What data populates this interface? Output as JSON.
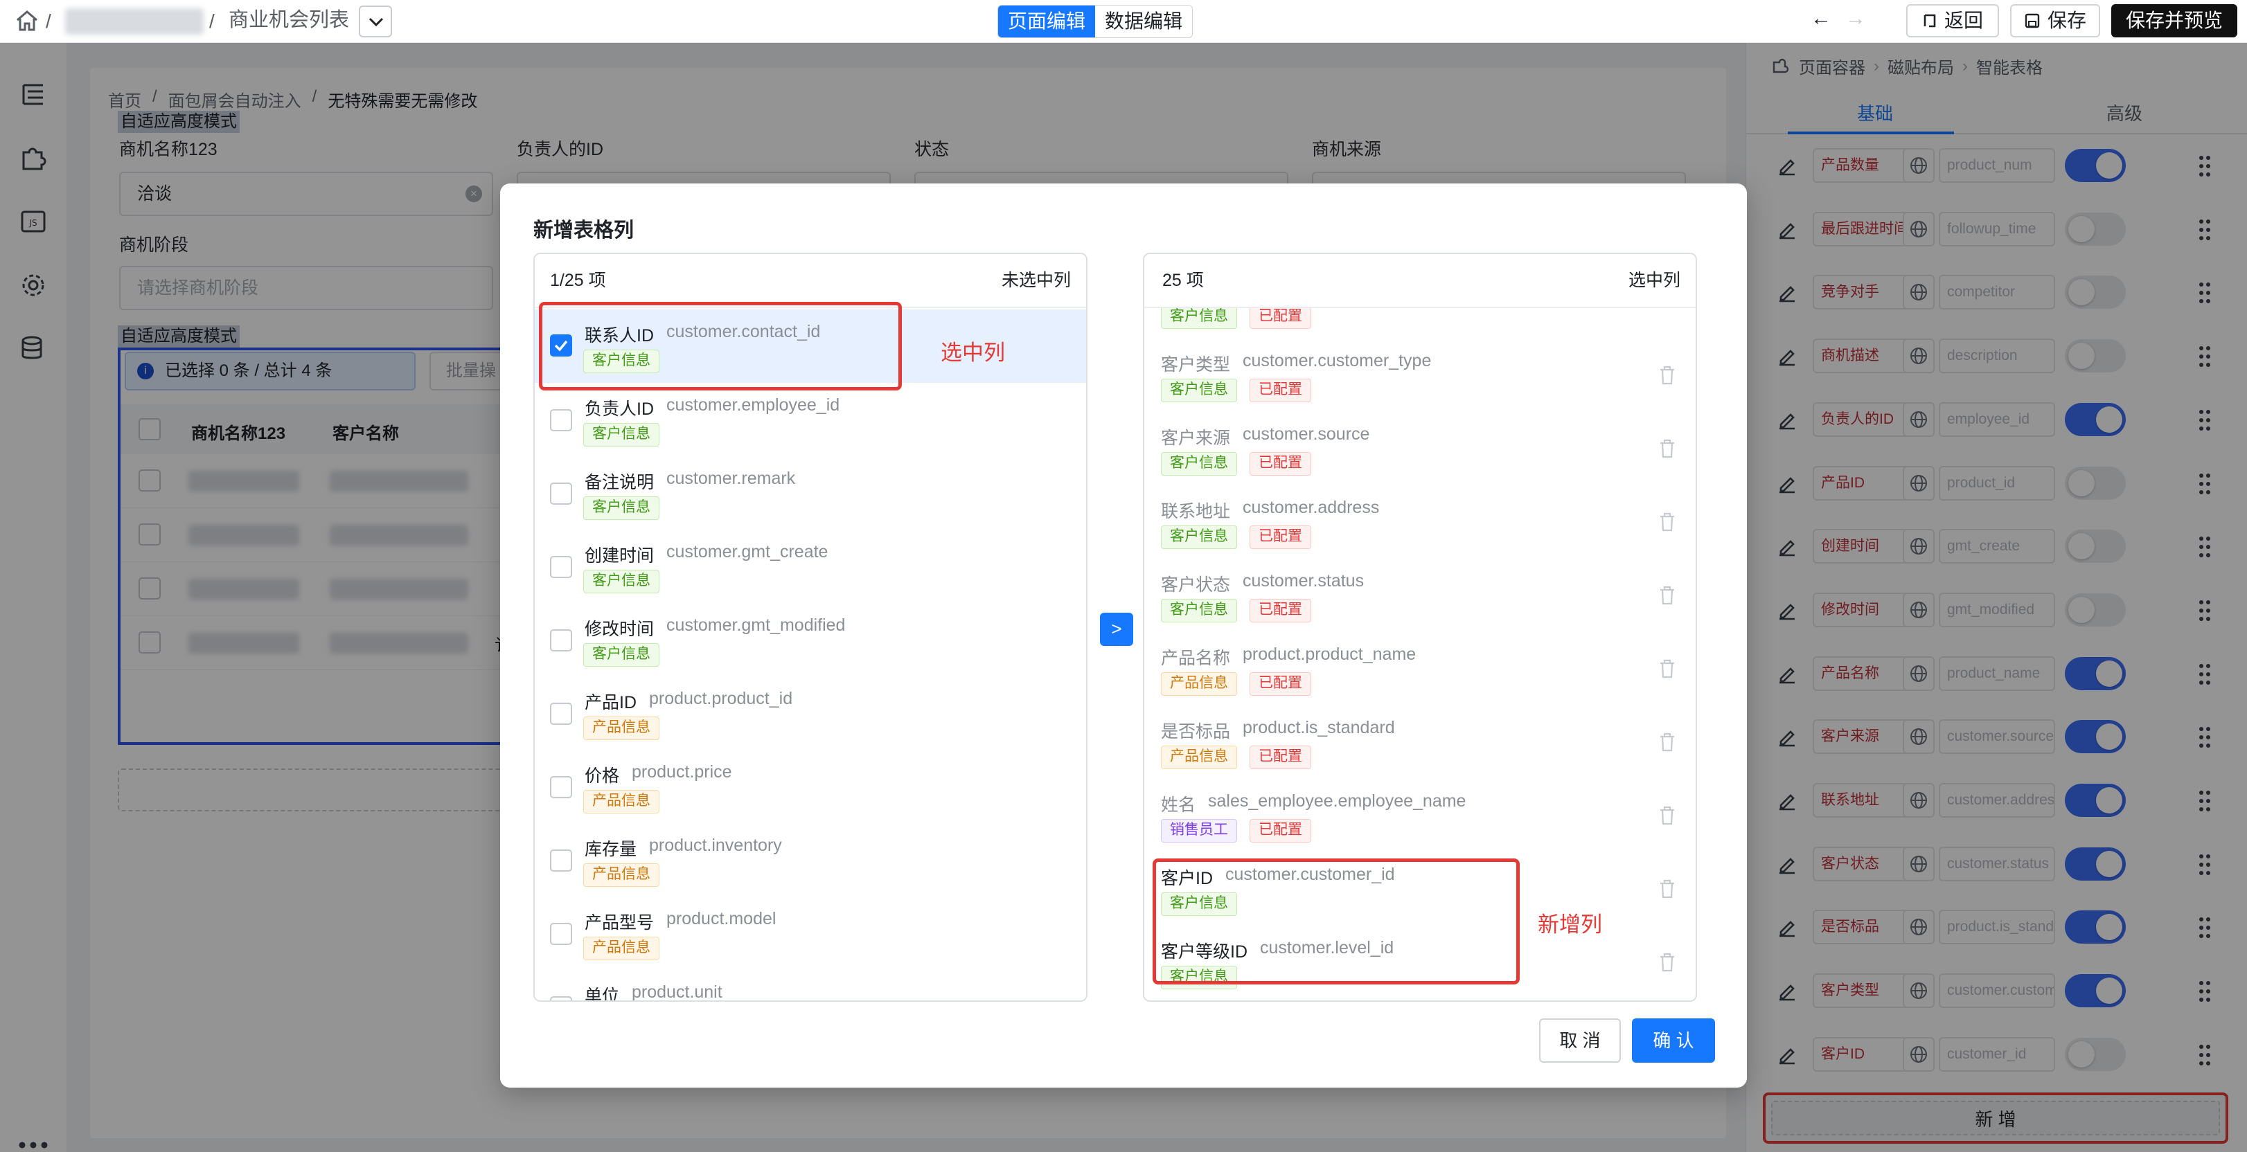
{
  "topbar": {
    "breadcrumb_sep1": "/",
    "breadcrumb_sep2": "/",
    "page_name": "商业机会列表",
    "mode_page_edit": "页面编辑",
    "mode_data_edit": "数据编辑",
    "undo": "←",
    "redo": "→",
    "back_label": "返回",
    "save_label": "保存",
    "save_preview_label": "保存并预览"
  },
  "canvas": {
    "breadcrumb": [
      "首页",
      "/",
      "面包屑会自动注入",
      "/",
      "无特殊需要无需修改"
    ],
    "adaptive_label_1": "自适应高度模式",
    "adaptive_label_2": "自适应高度模式",
    "fields": [
      {
        "label": "商机名称123",
        "value": "洽谈"
      },
      {
        "label": "负责人的ID",
        "value": ""
      },
      {
        "label": "状态",
        "value": ""
      },
      {
        "label": "商机来源",
        "value": ""
      }
    ],
    "stage_label": "商机阶段",
    "stage_placeholder": "请选择商机阶段",
    "selection_info": "已选择 0 条 / 总计 4 条",
    "batch_label": "批量操",
    "table_headers": [
      "商机名称123",
      "客户名称"
    ],
    "partial_text": "讠"
  },
  "right_panel": {
    "breadcrumb": [
      "页面容器",
      "磁贴布局",
      "智能表格"
    ],
    "tabs": [
      {
        "label": "基础"
      },
      {
        "label": "高级"
      }
    ],
    "rows": [
      {
        "label": "产品数量",
        "field": "product_num",
        "on": true
      },
      {
        "label": "最后跟进时间",
        "field": "followup_time",
        "on": false
      },
      {
        "label": "竞争对手",
        "field": "competitor",
        "on": false
      },
      {
        "label": "商机描述",
        "field": "description",
        "on": false
      },
      {
        "label": "负责人的ID",
        "field": "employee_id",
        "on": true
      },
      {
        "label": "产品ID",
        "field": "product_id",
        "on": false
      },
      {
        "label": "创建时间",
        "field": "gmt_create",
        "on": false
      },
      {
        "label": "修改时间",
        "field": "gmt_modified",
        "on": false
      },
      {
        "label": "产品名称",
        "field": "product_name",
        "on": true
      },
      {
        "label": "客户来源",
        "field": "customer.source",
        "on": true
      },
      {
        "label": "联系地址",
        "field": "customer.address",
        "on": true
      },
      {
        "label": "客户状态",
        "field": "customer.status",
        "on": true
      },
      {
        "label": "是否标品",
        "field": "product.is_standard",
        "on": true
      },
      {
        "label": "客户类型",
        "field": "customer.customer_type",
        "on": true
      },
      {
        "label": "客户ID",
        "field": "customer_id",
        "on": false
      }
    ],
    "add_label": "新 增"
  },
  "modal": {
    "title": "新增表格列",
    "left_panel": {
      "count": "1/25 项",
      "title": "未选中列",
      "items": [
        {
          "name": "联系人ID",
          "code": "customer.contact_id",
          "tag": "客户信息",
          "checked": true
        },
        {
          "name": "负责人ID",
          "code": "customer.employee_id",
          "tag": "客户信息",
          "checked": false
        },
        {
          "name": "备注说明",
          "code": "customer.remark",
          "tag": "客户信息",
          "checked": false
        },
        {
          "name": "创建时间",
          "code": "customer.gmt_create",
          "tag": "客户信息",
          "checked": false
        },
        {
          "name": "修改时间",
          "code": "customer.gmt_modified",
          "tag": "客户信息",
          "checked": false
        },
        {
          "name": "产品ID",
          "code": "product.product_id",
          "tag": "产品信息",
          "checked": false
        },
        {
          "name": "价格",
          "code": "product.price",
          "tag": "产品信息",
          "checked": false
        },
        {
          "name": "库存量",
          "code": "product.inventory",
          "tag": "产品信息",
          "checked": false
        },
        {
          "name": "产品型号",
          "code": "product.model",
          "tag": "产品信息",
          "checked": false
        },
        {
          "name": "单位",
          "code": "product.unit",
          "tag": "",
          "checked": false
        }
      ]
    },
    "right_panel": {
      "count": "25 项",
      "title": "选中列",
      "top_partial": {
        "tag": "客户信息",
        "status": "已配置"
      },
      "items": [
        {
          "name": "客户类型",
          "code": "customer.customer_type",
          "tag": "客户信息",
          "tag_type": "green",
          "status": "已配置"
        },
        {
          "name": "客户来源",
          "code": "customer.source",
          "tag": "客户信息",
          "tag_type": "green",
          "status": "已配置"
        },
        {
          "name": "联系地址",
          "code": "customer.address",
          "tag": "客户信息",
          "tag_type": "green",
          "status": "已配置"
        },
        {
          "name": "客户状态",
          "code": "customer.status",
          "tag": "客户信息",
          "tag_type": "green",
          "status": "已配置"
        },
        {
          "name": "产品名称",
          "code": "product.product_name",
          "tag": "产品信息",
          "tag_type": "orange",
          "status": "已配置"
        },
        {
          "name": "是否标品",
          "code": "product.is_standard",
          "tag": "产品信息",
          "tag_type": "orange",
          "status": "已配置"
        },
        {
          "name": "姓名",
          "code": "sales_employee.employee_name",
          "tag": "销售员工",
          "tag_type": "purple",
          "status": "已配置"
        },
        {
          "name": "客户ID",
          "code": "customer.customer_id",
          "tag": "客户信息",
          "tag_type": "green",
          "status": ""
        },
        {
          "name": "客户等级ID",
          "code": "customer.level_id",
          "tag": "客户信息",
          "tag_type": "green",
          "status": ""
        }
      ]
    },
    "transfer_arrow": ">",
    "cancel_label": "取 消",
    "confirm_label": "确 认"
  },
  "annotations": {
    "selected_note": "选中列",
    "new_note": "新增列"
  },
  "colors": {
    "primary": "#1677ff",
    "switch_on": "#3d6ef6",
    "annotation_red": "#e53935"
  }
}
